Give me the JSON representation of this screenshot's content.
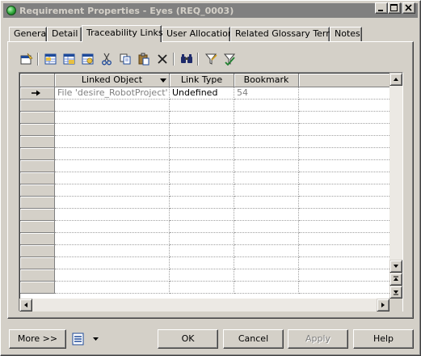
{
  "window": {
    "title": "Requirement Properties - Eyes (REQ_0003)",
    "buttons": {
      "minimize": "_",
      "maximize": "□",
      "close": "×"
    }
  },
  "tabs": [
    {
      "label": "General"
    },
    {
      "label": "Detail"
    },
    {
      "label": "Traceability Links",
      "active": true
    },
    {
      "label": "User Allocations"
    },
    {
      "label": "Related Glossary Terms"
    },
    {
      "label": "Notes"
    }
  ],
  "toolbar": {
    "icons": [
      "properties-icon",
      "insert-row-icon",
      "add-row-icon",
      "add-objects-icon",
      "cut-icon",
      "copy-icon",
      "paste-icon",
      "delete-icon",
      "find-icon",
      "filter-icon",
      "customize-columns-icon"
    ]
  },
  "grid": {
    "columns": [
      "Linked Object",
      "Link Type",
      "Bookmark"
    ],
    "rows": [
      {
        "linked_object": "File 'desire_RobotProject'",
        "link_type": "Undefined",
        "bookmark": "54",
        "current": true
      }
    ],
    "empty_rows": 16
  },
  "buttons": {
    "more": "More >>",
    "ok": "OK",
    "cancel": "Cancel",
    "apply": "Apply",
    "help": "Help"
  },
  "colors": {
    "face": "#d4d0c8",
    "title_inactive": "#808080",
    "title_text": "#d4d0c8",
    "grid_bg": "#ffffff",
    "dim_text": "#808080"
  }
}
